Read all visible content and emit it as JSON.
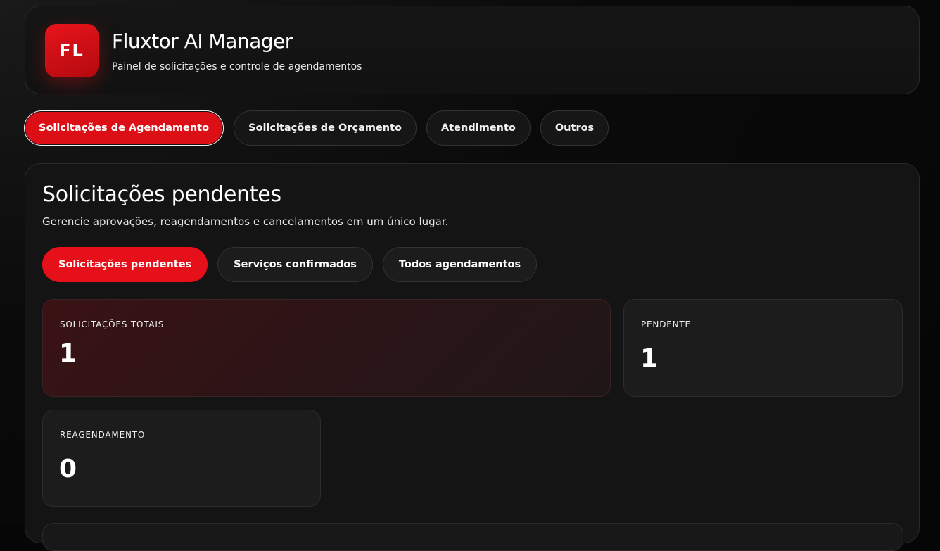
{
  "header": {
    "logo_text": "FL",
    "title": "Fluxtor AI Manager",
    "subtitle": "Painel de solicitações e controle de agendamentos"
  },
  "main_tabs": [
    {
      "label": "Solicitações de Agendamento",
      "active": true
    },
    {
      "label": "Solicitações de Orçamento",
      "active": false
    },
    {
      "label": "Atendimento",
      "active": false
    },
    {
      "label": "Outros",
      "active": false
    }
  ],
  "panel": {
    "title": "Solicitações pendentes",
    "description": "Gerencie aprovações, reagendamentos e cancelamentos em um único lugar.",
    "sub_tabs": [
      {
        "label": "Solicitações pendentes",
        "active": true
      },
      {
        "label": "Serviços confirmados",
        "active": false
      },
      {
        "label": "Todos agendamentos",
        "active": false
      }
    ],
    "stats": [
      {
        "label": "SOLICITAÇÕES TOTAIS",
        "value": "1"
      },
      {
        "label": "PENDENTE",
        "value": "1"
      },
      {
        "label": "REAGENDAMENTO",
        "value": "0"
      }
    ]
  },
  "colors": {
    "accent": "#e5101a",
    "background": "#060606",
    "card": "#1c1c1c"
  }
}
